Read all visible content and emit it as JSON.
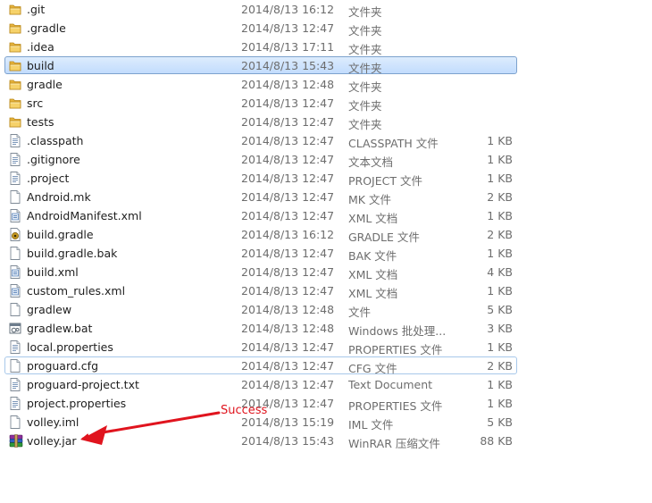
{
  "files": [
    {
      "name": ".git",
      "date": "2014/8/13 16:12",
      "type": "文件夹",
      "size": "",
      "icon": "folder-icon"
    },
    {
      "name": ".gradle",
      "date": "2014/8/13 12:47",
      "type": "文件夹",
      "size": "",
      "icon": "folder-icon"
    },
    {
      "name": ".idea",
      "date": "2014/8/13 17:11",
      "type": "文件夹",
      "size": "",
      "icon": "folder-icon"
    },
    {
      "name": "build",
      "date": "2014/8/13 15:43",
      "type": "文件夹",
      "size": "",
      "icon": "folder-icon",
      "state": "selected"
    },
    {
      "name": "gradle",
      "date": "2014/8/13 12:48",
      "type": "文件夹",
      "size": "",
      "icon": "folder-icon"
    },
    {
      "name": "src",
      "date": "2014/8/13 12:47",
      "type": "文件夹",
      "size": "",
      "icon": "folder-icon"
    },
    {
      "name": "tests",
      "date": "2014/8/13 12:47",
      "type": "文件夹",
      "size": "",
      "icon": "folder-icon"
    },
    {
      "name": ".classpath",
      "date": "2014/8/13 12:47",
      "type": "CLASSPATH 文件",
      "size": "1 KB",
      "icon": "document-lines-icon"
    },
    {
      "name": ".gitignore",
      "date": "2014/8/13 12:47",
      "type": "文本文档",
      "size": "1 KB",
      "icon": "document-lines-icon"
    },
    {
      "name": ".project",
      "date": "2014/8/13 12:47",
      "type": "PROJECT 文件",
      "size": "1 KB",
      "icon": "document-lines-icon"
    },
    {
      "name": "Android.mk",
      "date": "2014/8/13 12:47",
      "type": "MK 文件",
      "size": "2 KB",
      "icon": "blank-file-icon"
    },
    {
      "name": "AndroidManifest.xml",
      "date": "2014/8/13 12:47",
      "type": "XML 文档",
      "size": "1 KB",
      "icon": "xml-file-icon"
    },
    {
      "name": "build.gradle",
      "date": "2014/8/13 16:12",
      "type": "GRADLE 文件",
      "size": "2 KB",
      "icon": "gradle-file-icon"
    },
    {
      "name": "build.gradle.bak",
      "date": "2014/8/13 12:47",
      "type": "BAK 文件",
      "size": "1 KB",
      "icon": "blank-file-icon"
    },
    {
      "name": "build.xml",
      "date": "2014/8/13 12:47",
      "type": "XML 文档",
      "size": "4 KB",
      "icon": "xml-file-icon"
    },
    {
      "name": "custom_rules.xml",
      "date": "2014/8/13 12:47",
      "type": "XML 文档",
      "size": "1 KB",
      "icon": "xml-file-icon"
    },
    {
      "name": "gradlew",
      "date": "2014/8/13 12:48",
      "type": "文件",
      "size": "5 KB",
      "icon": "blank-file-icon"
    },
    {
      "name": "gradlew.bat",
      "date": "2014/8/13 12:48",
      "type": "Windows 批处理...",
      "size": "3 KB",
      "icon": "batch-file-icon"
    },
    {
      "name": "local.properties",
      "date": "2014/8/13 12:47",
      "type": "PROPERTIES 文件",
      "size": "1 KB",
      "icon": "document-lines-icon"
    },
    {
      "name": "proguard.cfg",
      "date": "2014/8/13 12:47",
      "type": "CFG 文件",
      "size": "2 KB",
      "icon": "blank-file-icon",
      "state": "focused"
    },
    {
      "name": "proguard-project.txt",
      "date": "2014/8/13 12:47",
      "type": "Text Document",
      "size": "1 KB",
      "icon": "document-lines-icon"
    },
    {
      "name": "project.properties",
      "date": "2014/8/13 12:47",
      "type": "PROPERTIES 文件",
      "size": "1 KB",
      "icon": "document-lines-icon"
    },
    {
      "name": "volley.iml",
      "date": "2014/8/13 15:19",
      "type": "IML 文件",
      "size": "5 KB",
      "icon": "blank-file-icon"
    },
    {
      "name": "volley.jar",
      "date": "2014/8/13 15:43",
      "type": "WinRAR 压缩文件",
      "size": "88 KB",
      "icon": "winrar-archive-icon"
    }
  ],
  "annotation": {
    "label": "Success",
    "color": "#e0141e"
  }
}
